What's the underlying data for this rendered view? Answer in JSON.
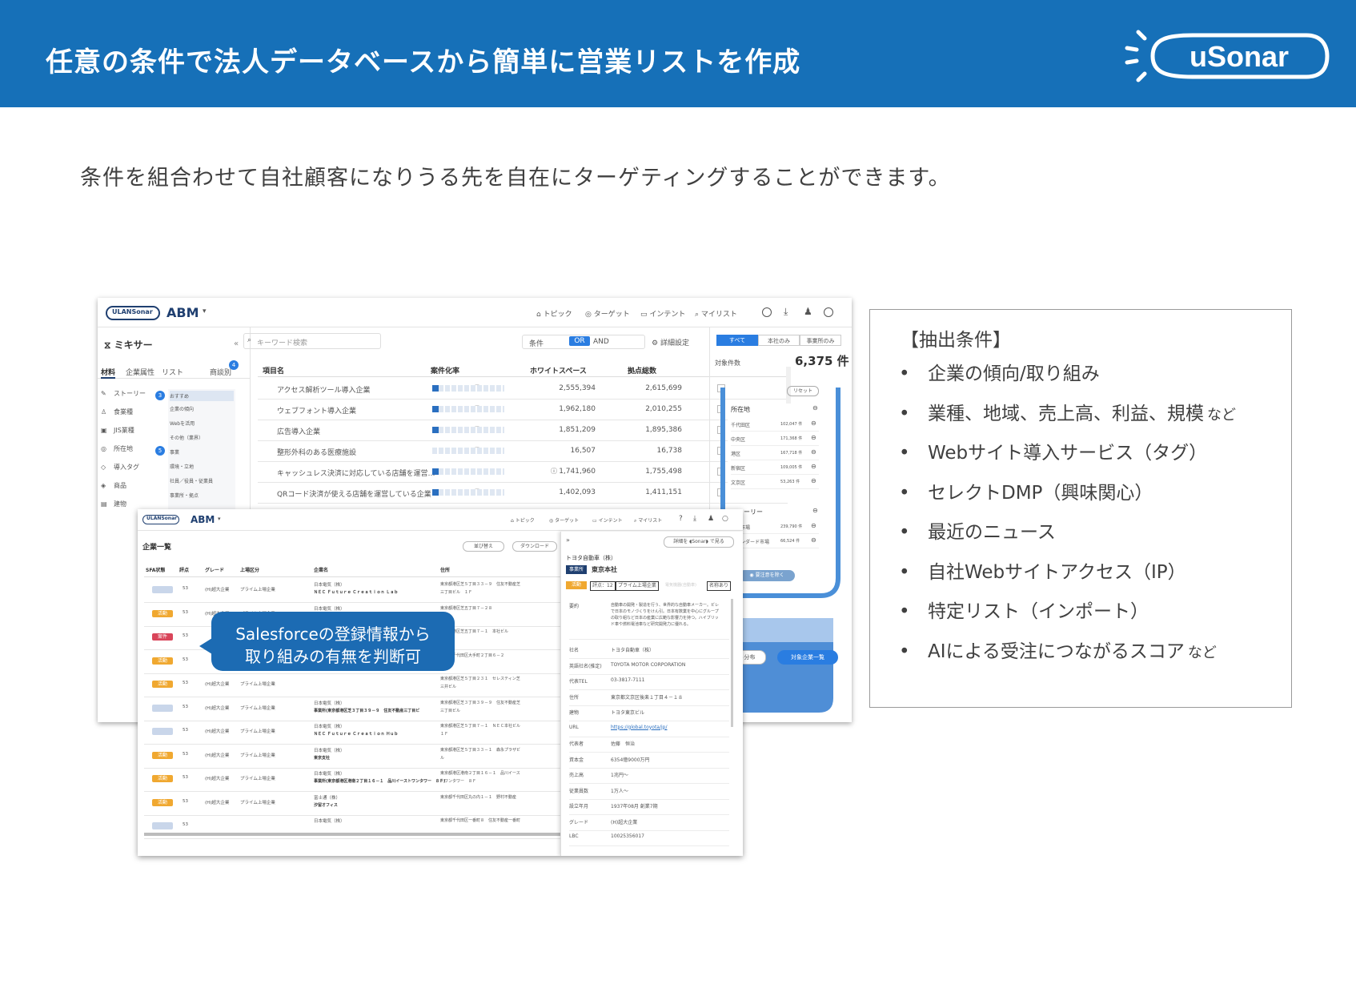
{
  "header": {
    "title": "任意の条件で法人データベースから簡単に営業リストを作成",
    "brand": "uSonar"
  },
  "lead": "条件を組合わせて自社顧客になりうる先を自在にターゲティングすることができます。",
  "conditions": {
    "title": "【抽出条件】",
    "items": [
      {
        "text": "企業の傾向/取り組み",
        "suffix": ""
      },
      {
        "text": "業種、地域、売上高、利益、規模",
        "suffix": "など"
      },
      {
        "text": "Webサイト導入サービス（タグ）",
        "suffix": ""
      },
      {
        "text": "セレクトDMP（興味関心）",
        "suffix": ""
      },
      {
        "text": "最近のニュース",
        "suffix": ""
      },
      {
        "text": "自社Webサイトアクセス（IP）",
        "suffix": ""
      },
      {
        "text": "特定リスト（インポート）",
        "suffix": ""
      },
      {
        "text": "AIによる受注につながるスコア",
        "suffix": "など"
      }
    ]
  },
  "callout": {
    "line1": "Salesforceの登録情報から",
    "line2": "取り組みの有無を判断可"
  },
  "screen1": {
    "logo_text": "ULANSonar",
    "app": "ABM",
    "nav": [
      "トピック",
      "ターゲット",
      "インテント",
      "マイリスト"
    ],
    "sidebar_title": "ミキサー",
    "sidebar_tabs": [
      "材料",
      "企業属性",
      "リスト",
      "商談別"
    ],
    "categories": [
      "ストーリー",
      "食業種",
      "JIS業種",
      "所在地",
      "導入タグ",
      "商品",
      "建物"
    ],
    "subitems": [
      "おすすめ",
      "企業の傾向",
      "Webを活用",
      "その他（業界）",
      "事業",
      "環境・立地",
      "社員／役員・従業員",
      "事業所・拠点"
    ],
    "search_placeholder": "キーワード検索",
    "filter_label": "条件",
    "or_label": "OR",
    "and_label": "AND",
    "detail_setting": "詳細設定",
    "columns": [
      "項目名",
      "案件化率",
      "ホワイトスペース",
      "拠点総数"
    ],
    "rows": [
      {
        "name": "アクセス解析ツール導入企業",
        "ws": "2,555,394",
        "total": "2,615,699"
      },
      {
        "name": "ウェブフォント導入企業",
        "ws": "1,962,180",
        "total": "2,010,255"
      },
      {
        "name": "広告導入企業",
        "ws": "1,851,209",
        "total": "1,895,386"
      },
      {
        "name": "整形外科のある医療施設",
        "ws": "16,507",
        "total": "16,738"
      },
      {
        "name": "キャッシュレス決済に対応している店舗を運営…",
        "ws": "1,741,960",
        "total": "1,755,498"
      },
      {
        "name": "QRコード決済が使える店舗を運営している企業",
        "ws": "1,402,093",
        "total": "1,411,151"
      }
    ],
    "right_tabs": [
      "すべて",
      "本社のみ",
      "事業所のみ"
    ],
    "target_label": "対象件数",
    "target_count": "6,375 件",
    "reset": "リセット",
    "location_label": "所在地",
    "locations": [
      {
        "name": "千代田区",
        "count": "102,047 件"
      },
      {
        "name": "中央区",
        "count": "171,368 件"
      },
      {
        "name": "港区",
        "count": "167,718 件"
      },
      {
        "name": "新宿区",
        "count": "109,005 件"
      },
      {
        "name": "文京区",
        "count": "53,263 件"
      }
    ],
    "story_label": "ストーリー",
    "stories": [
      {
        "name": "成長市場",
        "count": "239,790 件"
      },
      {
        "name": "スタンダード市場",
        "count": "66,524 件"
      }
    ],
    "extract_btn": "要注意を除く",
    "bottom_btn1": "ト分布",
    "bottom_btn2": "対象企業一覧"
  },
  "screen2": {
    "logo_text": "ULANSonar",
    "app": "ABM",
    "nav": [
      "トピック",
      "ターゲット",
      "インテント",
      "マイリスト"
    ],
    "list_title": "企業一覧",
    "sort_btn": "並び替え",
    "download_btn": "ダウンロード",
    "columns": [
      "SFA状態",
      "評点",
      "グレード",
      "上場区分",
      "企業名",
      "住所"
    ],
    "rows": [
      {
        "status": "",
        "color": "#c9d6ea",
        "score": "53",
        "grade": "(H)超大企業",
        "listing": "プライム上場企業",
        "name": "日本電気（株）",
        "sub": "ＮＥＣ Ｆｕｔｕｒｅ Ｃｒｅａｔｉｏｎ Ｌａｂ",
        "addr": "東京都港区芝５丁目３３－９　住友不動産芝",
        "addr2": "三丁目ビル　１Ｆ"
      },
      {
        "status": "活動",
        "color": "#f0a830",
        "score": "53",
        "grade": "(H)超大企業",
        "listing": "プライム上場企業",
        "name": "日本電気（株）",
        "sub": "",
        "addr": "東京都港区芝五丁目７－２８",
        "addr2": ""
      },
      {
        "status": "案件",
        "color": "#d9455a",
        "score": "53",
        "grade": "",
        "listing": "",
        "name": "",
        "sub": "",
        "addr": "東京都港区芝五丁目７－１　本社ビル",
        "addr2": ""
      },
      {
        "status": "活動",
        "color": "#f0a830",
        "score": "53",
        "grade": "",
        "listing": "",
        "name": "",
        "sub": "",
        "addr": "東京都千代田区大手町２丁目６－２",
        "addr2": ""
      },
      {
        "status": "活動",
        "color": "#f0a830",
        "score": "53",
        "grade": "(H)超大企業",
        "listing": "プライム上場企業",
        "name": "",
        "sub": "",
        "addr": "東京都港区芝５丁目２３１　セレスティン芝",
        "addr2": "三井ビル"
      },
      {
        "status": "",
        "color": "#c9d6ea",
        "score": "53",
        "grade": "(H)超大企業",
        "listing": "プライム上場企業",
        "name": "日本電気（株）",
        "sub": "事業所(東京都港区芝３丁目３９－９　住友不動産三丁目ビ",
        "addr": "東京都港区芝３丁目３９－９　住友不動産芝",
        "addr2": "三丁目ビル"
      },
      {
        "status": "",
        "color": "#c9d6ea",
        "score": "53",
        "grade": "(H)超大企業",
        "listing": "プライム上場企業",
        "name": "日本電気（株）",
        "sub": "ＮＥＣ Ｆｕｔｕｒｅ Ｃｒｅａｔｉｏｎ Ｈｕｂ",
        "addr": "東京都港区芝５丁目７－１　ＮＥＣ本社ビル",
        "addr2": "１Ｆ"
      },
      {
        "status": "活動",
        "color": "#f0a830",
        "score": "53",
        "grade": "(H)超大企業",
        "listing": "プライム上場企業",
        "name": "日本電気（株）",
        "sub": "東京支社",
        "addr": "東京都港区芝５丁目３３－１　森永プラザビ",
        "addr2": "ル"
      },
      {
        "status": "活動",
        "color": "#f0a830",
        "score": "53",
        "grade": "(H)超大企業",
        "listing": "プライム上場企業",
        "name": "日本電気（株）",
        "sub": "事業所(東京都港区港南２丁目１６－１　品川イーストワンタワー　８Ｆ)",
        "addr": "東京都港区港南２丁目１６－１　品川イース",
        "addr2": "トワンタワー　８Ｆ"
      },
      {
        "status": "活動",
        "color": "#f0a830",
        "score": "53",
        "grade": "(H)超大企業",
        "listing": "プライム上場企業",
        "name": "富士通（株）",
        "sub": "汐留オフィス",
        "addr": "東京都千代田区丸の内１－１　野村不動産",
        "addr2": ""
      },
      {
        "status": "",
        "color": "#c9d6ea",
        "score": "53",
        "grade": "",
        "listing": "",
        "name": "日本電気（株）",
        "sub": "",
        "addr": "東京都千代田区一番町８　住友不動産一番町",
        "addr2": ""
      }
    ],
    "detail": {
      "company": "トヨタ自動車（株）",
      "hq_badge": "事業所",
      "hq_name": "東京本社",
      "chip_status": "活動",
      "chip_score": "評点：12",
      "chip_listing": "プライム上場企業",
      "chip_hidden": "電気機器(自動車)",
      "chip_name": "名称あり",
      "detail_btn": "詳細を",
      "view_btn": "で見る",
      "summary_label": "要約",
      "summary": "自動車の開発・製造を行う、世界的な自動車メーカー。ビレで日本のモノづくりをけん引。日本有数業を中心にグループの取り組など日本の産業に広範な影響力を持つ。ハイブリッド車や燃料電池車など研究開発力に優れる。",
      "fields": [
        {
          "k": "社名",
          "v": "トヨタ自動車（株）"
        },
        {
          "k": "英語社名(推定)",
          "v": "TOYOTA MOTOR CORPORATION"
        },
        {
          "k": "代表TEL",
          "v": "03-3817-7111"
        },
        {
          "k": "住所",
          "v": "東京都文京区後楽１丁目４－１８"
        },
        {
          "k": "建物",
          "v": "トヨタ東京ビル"
        },
        {
          "k": "URL",
          "v": "https://global.toyota/jp/"
        },
        {
          "k": "代表者",
          "v": "佐藤　恒治"
        },
        {
          "k": "資本金",
          "v": "6354億9000万円"
        },
        {
          "k": "売上高",
          "v": "1兆円〜"
        },
        {
          "k": "従業員数",
          "v": "1万人〜"
        },
        {
          "k": "設立年月",
          "v": "1937年08月 創業7期"
        },
        {
          "k": "グレード",
          "v": "(H)超大企業"
        },
        {
          "k": "LBC",
          "v": "10025356017"
        }
      ]
    }
  }
}
